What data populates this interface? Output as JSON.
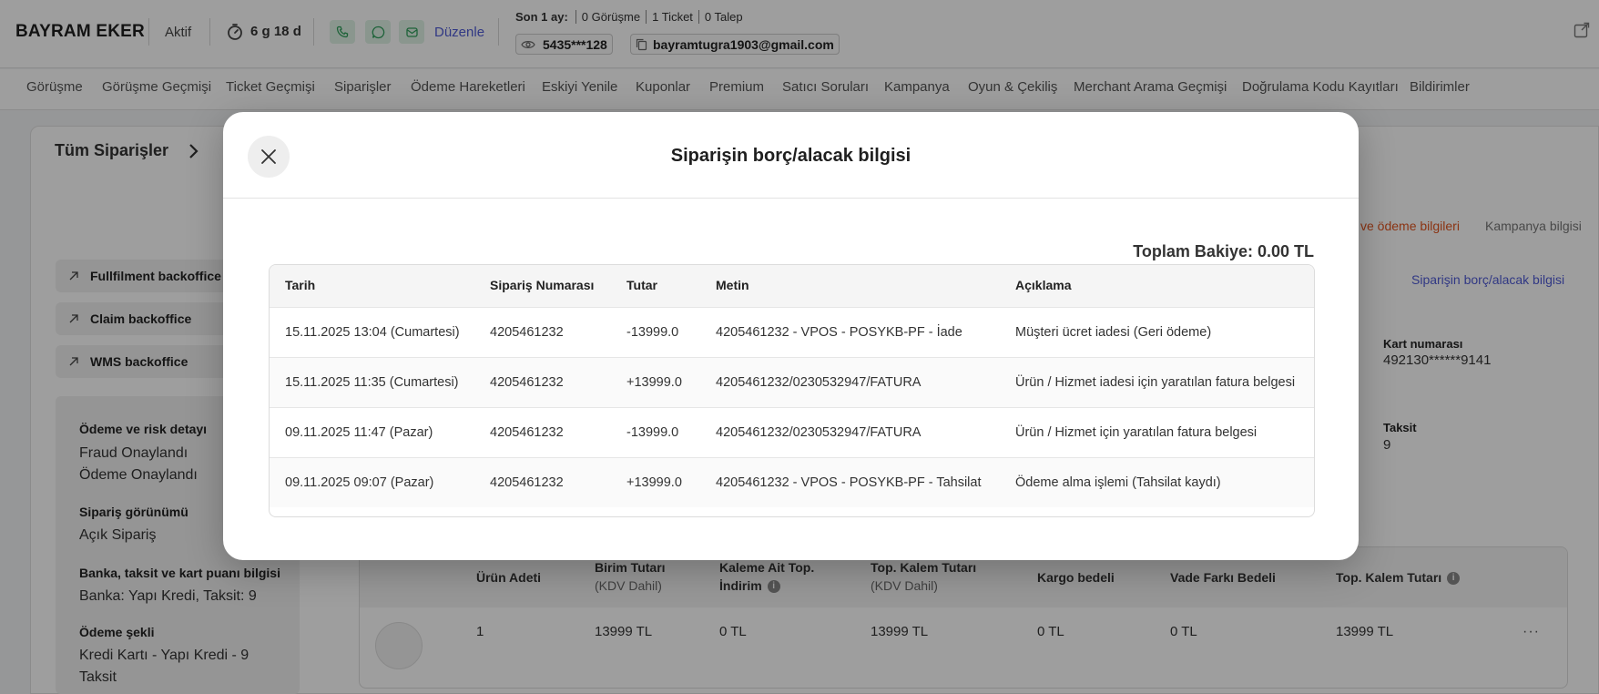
{
  "header": {
    "customer_name": "BAYRAM EKER",
    "status": "Aktif",
    "tenure": "6 g 18 d",
    "edit_label": "Düzenle",
    "stats_label": "Son 1 ay:",
    "stats": [
      "0 Görüşme",
      "1 Ticket",
      "0 Talep"
    ],
    "phone": "5435***128",
    "email": "bayramtugra1903@gmail.com"
  },
  "nav": {
    "tabs": [
      "Görüşme",
      "Görüşme Geçmişi",
      "Ticket Geçmişi",
      "Siparişler",
      "Ödeme Hareketleri",
      "Eskiyi Yenile",
      "Kuponlar",
      "Premium",
      "Satıcı Soruları",
      "Kampanya",
      "Oyun & Çekiliş",
      "Merchant Arama Geçmişi",
      "Doğrulama Kodu Kayıtları",
      "Bildirimler"
    ]
  },
  "background": {
    "breadcrumb": "Tüm Siparişler",
    "backoffice_buttons": [
      "Fullfilment backoffice",
      "Claim backoffice",
      "WMS backoffice"
    ],
    "left_panel": [
      {
        "label": "Ödeme ve risk detayı",
        "value": "Fraud Onaylandı\nÖdeme Onaylandı"
      },
      {
        "label": "Sipariş görünümü",
        "value": "Açık Sipariş"
      },
      {
        "label": "Banka, taksit ve kart puanı bilgisi",
        "value": "Banka: Yapı Kredi, Taksit: 9"
      },
      {
        "label": "Ödeme şekli",
        "value": "Kredi Kartı - Yapı Kredi - 9 Taksit"
      }
    ],
    "right_tab_active": "ve ödeme bilgileri",
    "right_tab_other": "Kampanya bilgisi",
    "debt_link": "Siparişin borç/alacak bilgisi",
    "card_number_label": "Kart numarası",
    "card_number": "492130******9141",
    "installment_label": "Taksit",
    "installment": "9",
    "product_table": {
      "headers": [
        {
          "title": "Ürün Adeti",
          "sub": ""
        },
        {
          "title": "Birim Tutarı",
          "sub": "(KDV Dahil)"
        },
        {
          "title": "Kaleme Ait Top. İndirim",
          "sub": ""
        },
        {
          "title": "Top. Kalem Tutarı",
          "sub": "(KDV Dahil)"
        },
        {
          "title": "Kargo bedeli",
          "sub": ""
        },
        {
          "title": "Vade Farkı Bedeli",
          "sub": ""
        },
        {
          "title": "Top. Kalem Tutarı",
          "sub": ""
        }
      ],
      "row": [
        "1",
        "13999 TL",
        "0 TL",
        "13999 TL",
        "0 TL",
        "0 TL",
        "13999 TL"
      ],
      "more": "···"
    }
  },
  "modal": {
    "title": "Siparişin borç/alacak bilgisi",
    "balance": "Toplam Bakiye: 0.00 TL",
    "columns": [
      "Tarih",
      "Sipariş Numarası",
      "Tutar",
      "Metin",
      "Açıklama"
    ],
    "rows": [
      [
        "15.11.2025 13:04 (Cumartesi)",
        "4205461232",
        "-13999.0",
        "4205461232 - VPOS - POSYKB-PF - İade",
        "Müşteri ücret iadesi (Geri ödeme)"
      ],
      [
        "15.11.2025 11:35 (Cumartesi)",
        "4205461232",
        "+13999.0",
        "4205461232/0230532947/FATURA",
        "Ürün / Hizmet iadesi için yaratılan fatura belgesi"
      ],
      [
        "09.11.2025 11:47 (Pazar)",
        "4205461232",
        "-13999.0",
        "4205461232/0230532947/FATURA",
        "Ürün / Hizmet için yaratılan fatura belgesi"
      ],
      [
        "09.11.2025 09:07 (Pazar)",
        "4205461232",
        "+13999.0",
        "4205461232 - VPOS - POSYKB-PF - Tahsilat",
        "Ödeme alma işlemi (Tahsilat kaydı)"
      ]
    ]
  },
  "colors": {
    "accent_blue": "#4f5bd5",
    "accent_orange": "#e0541f",
    "green_button_bg": "#dff3e6",
    "green_icon": "#2f9e5b"
  },
  "icons": [
    "timer-icon",
    "phone-icon",
    "whatsapp-icon",
    "message-icon",
    "eye-icon",
    "copy-icon",
    "external-link-icon",
    "close-icon",
    "chevron-right-icon",
    "arrow-up-right-icon",
    "info-icon",
    "more-icon"
  ]
}
